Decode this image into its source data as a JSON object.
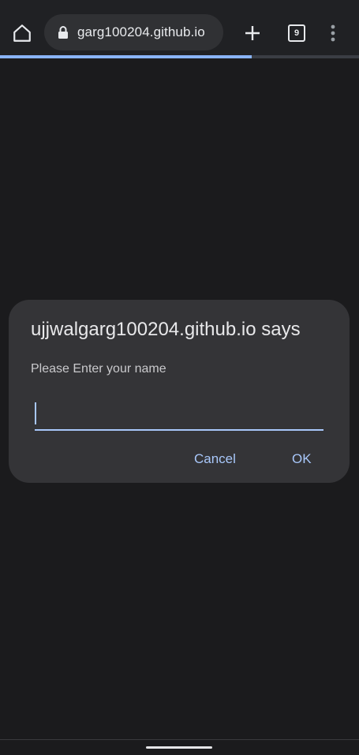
{
  "browser": {
    "url": "garg100204.github.io",
    "tab_count": "9",
    "load_progress": 0.7,
    "accent_color": "#8ab4f8"
  },
  "icons": {
    "home": "home-icon",
    "lock": "lock-icon",
    "new_tab": "plus-icon",
    "tabs": "tab-switcher-icon",
    "menu": "more-vert-icon"
  },
  "dialog": {
    "title": "ujjwalgarg100204.github.io says",
    "message": "Please Enter your name",
    "input_value": "",
    "cancel_label": "Cancel",
    "ok_label": "OK"
  }
}
